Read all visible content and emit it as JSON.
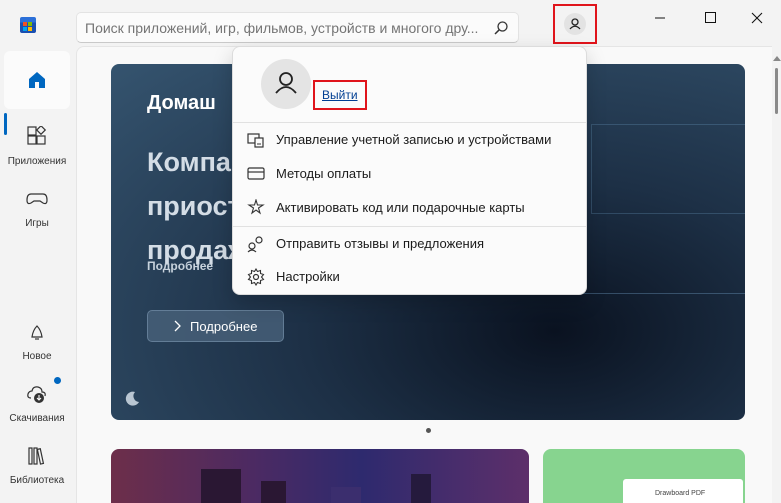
{
  "search": {
    "placeholder": "Поиск приложений, игр, фильмов, устройств и многого дру..."
  },
  "sidebar": {
    "items": [
      {
        "label": ""
      },
      {
        "label": "Приложения"
      },
      {
        "label": "Игры"
      },
      {
        "label": "Новое"
      },
      {
        "label": "Скачивания"
      },
      {
        "label": "Библиотека"
      }
    ]
  },
  "hero": {
    "title": "Домаш",
    "headline": "Компа приост продаж",
    "subtitle": "Подробнее",
    "button_label": "Подробнее"
  },
  "tiles": {
    "tile2_label": "Drawboard PDF"
  },
  "account_menu": {
    "signout_label": "Выйти",
    "items": [
      {
        "label": "Управление учетной записью и устройствами",
        "icon": "account-devices-icon"
      },
      {
        "label": "Методы оплаты",
        "icon": "card-icon"
      },
      {
        "label": "Активировать код или подарочные карты",
        "icon": "redeem-icon"
      },
      {
        "label": "Отправить отзывы и предложения",
        "icon": "feedback-icon"
      },
      {
        "label": "Настройки",
        "icon": "gear-icon"
      }
    ]
  },
  "colors": {
    "accent": "#0067c0",
    "highlight": "#e0141b"
  }
}
